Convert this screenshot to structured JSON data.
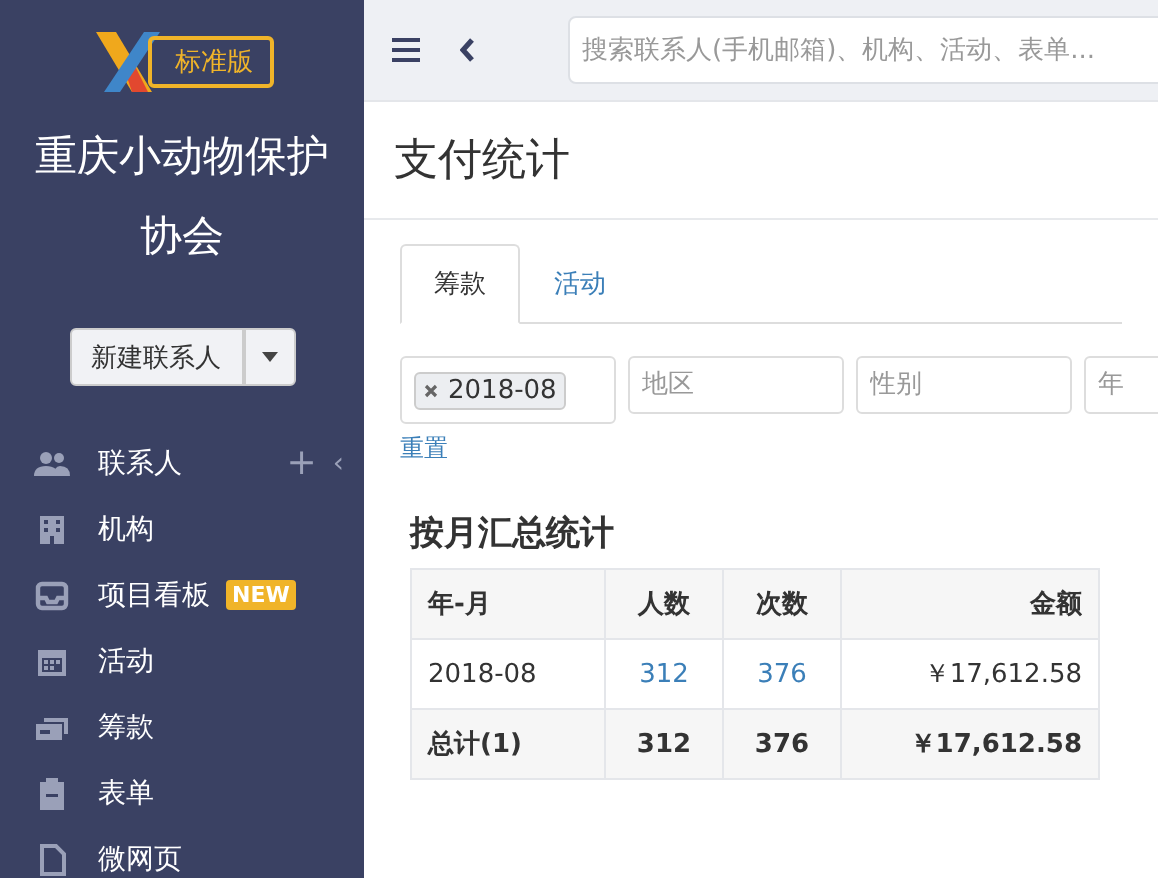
{
  "sidebar": {
    "edition_badge": "标准版",
    "org_name": "重庆小动物保护协会",
    "new_button": "新建联系人",
    "items": [
      {
        "kind": "people",
        "label": "联系人",
        "add": "+",
        "collapse": "‹"
      },
      {
        "kind": "building",
        "label": "机构"
      },
      {
        "kind": "inbox",
        "label": "项目看板",
        "badge": "NEW"
      },
      {
        "kind": "calendar",
        "label": "活动"
      },
      {
        "kind": "money",
        "label": "筹款"
      },
      {
        "kind": "clipboard",
        "label": "表单"
      },
      {
        "kind": "page",
        "label": "微网页"
      }
    ]
  },
  "topbar": {
    "search": {
      "placeholder": "搜索联系人(手机邮箱)、机构、活动、表单..."
    }
  },
  "page_title": "支付统计",
  "tabs": [
    {
      "label": "筹款",
      "selected": true
    },
    {
      "label": "活动",
      "selected": false
    }
  ],
  "filters": {
    "month_tags": [
      "2018-08"
    ],
    "fields": [
      {
        "placeholder": "地区"
      },
      {
        "placeholder": "性别"
      },
      {
        "placeholder": "年"
      }
    ],
    "reset": "重置"
  },
  "summary": {
    "title": "按月汇总统计",
    "columns": [
      "年-月",
      "人数",
      "次数",
      "金额"
    ],
    "rows": [
      {
        "month": "2018-08",
        "people": "312",
        "count": "376",
        "amount": "￥17,612.58"
      }
    ],
    "total": {
      "label": "总计(1)",
      "people": "312",
      "count": "376",
      "amount": "￥17,612.58"
    }
  }
}
